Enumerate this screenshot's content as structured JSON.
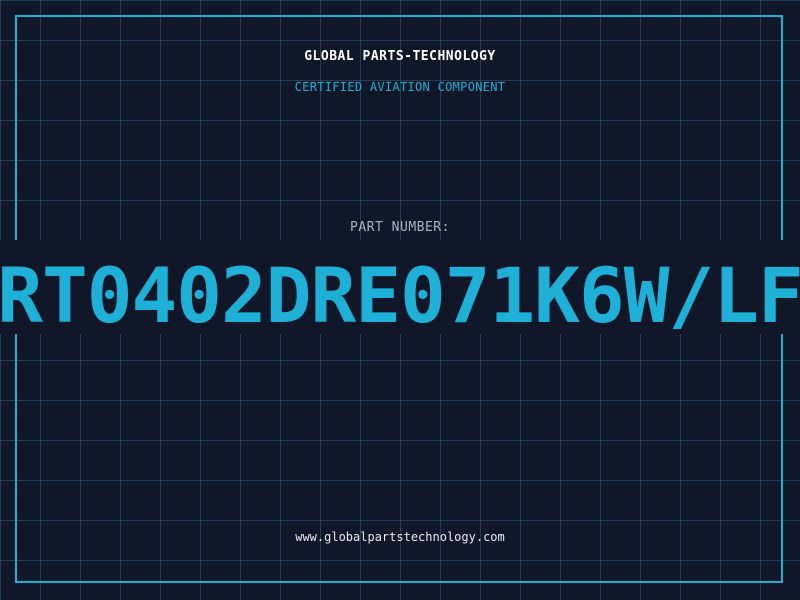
{
  "header": {
    "company": "GLOBAL PARTS-TECHNOLOGY",
    "subtitle": "CERTIFIED AVIATION COMPONENT"
  },
  "part": {
    "label": "PART NUMBER:",
    "number": "RT0402DRE071K6W/LF"
  },
  "footer": {
    "website": "www.globalpartstechnology.com"
  },
  "colors": {
    "background": "#0f1729",
    "accent": "#1fb0d8",
    "grid": "#2a6a80",
    "text": "#ffffff",
    "muted": "#a9b4c6"
  }
}
